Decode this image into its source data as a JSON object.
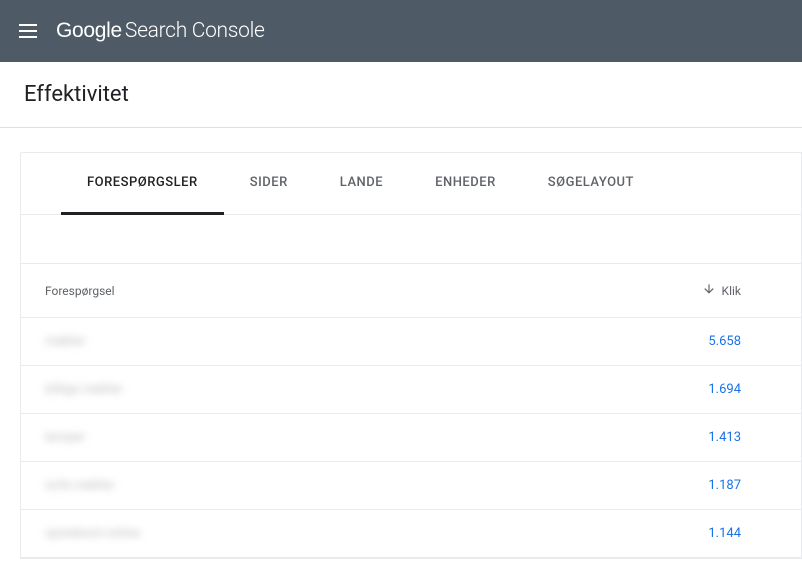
{
  "header": {
    "logo_google": "Google",
    "logo_product": "Search Console"
  },
  "page": {
    "title": "Effektivitet"
  },
  "tabs": [
    {
      "label": "FORESPØRGSLER",
      "active": true
    },
    {
      "label": "SIDER",
      "active": false
    },
    {
      "label": "LANDE",
      "active": false
    },
    {
      "label": "ENHEDER",
      "active": false
    },
    {
      "label": "SØGELAYOUT",
      "active": false
    }
  ],
  "table": {
    "columns": {
      "query": "Forespørgsel",
      "clicks": "Klik"
    },
    "rows": [
      {
        "query": "møbler",
        "clicks": "5.658"
      },
      {
        "query": "billige møbler",
        "clicks": "1.694"
      },
      {
        "query": "lamper",
        "clicks": "1.413"
      },
      {
        "query": "sofa møbler",
        "clicks": "1.187"
      },
      {
        "query": "spisebord online",
        "clicks": "1.144"
      }
    ]
  }
}
